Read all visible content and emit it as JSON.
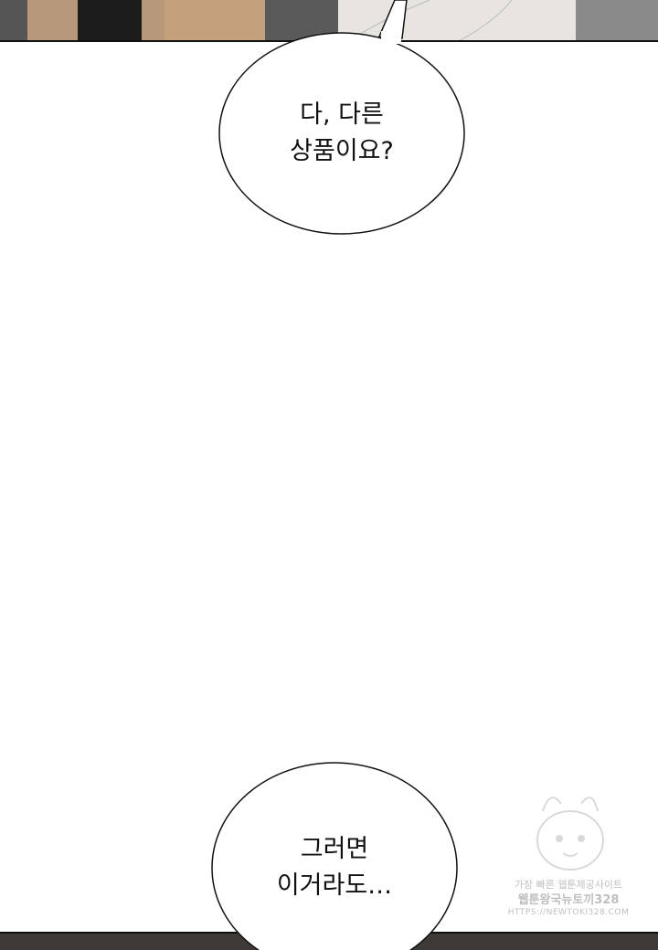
{
  "speech_bubbles": [
    {
      "lines": [
        "다, 다른",
        "상품이요?"
      ]
    },
    {
      "lines": [
        "그러면",
        "이거라도…"
      ]
    }
  ],
  "watermark": {
    "line1": "가장 빠른 웹툰제공사이트",
    "line2": "웹툰왕국뉴토끼328",
    "line3": "HTTPS://NEWTOKI328.COM"
  }
}
